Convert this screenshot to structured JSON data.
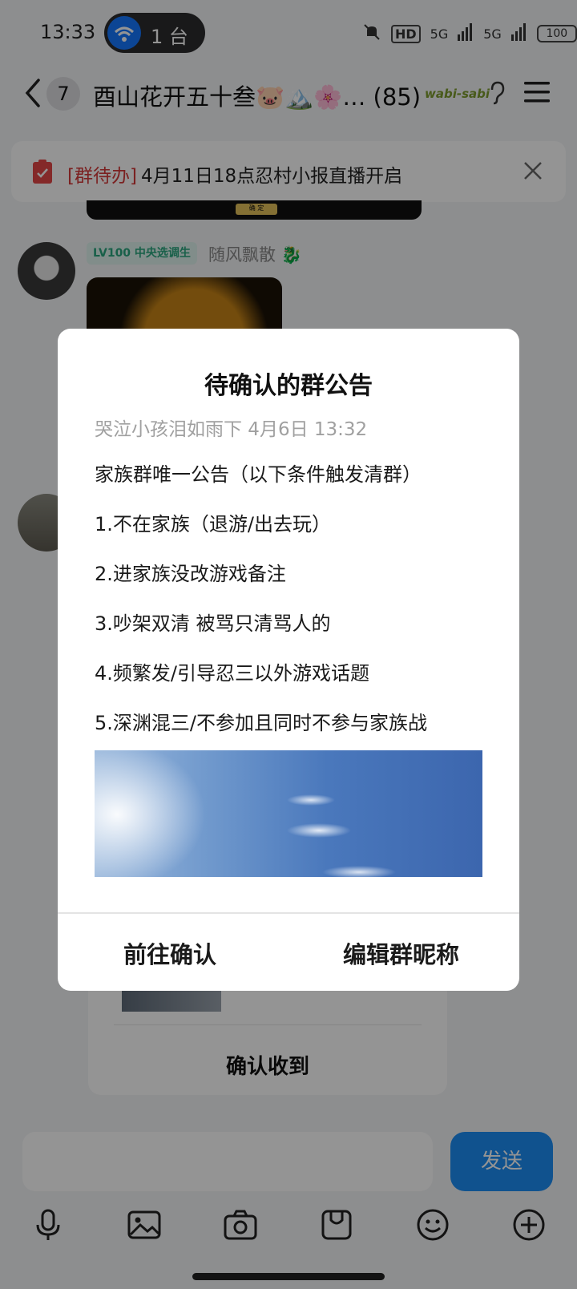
{
  "status_bar": {
    "time": "13:33",
    "hotspot_count": "1 台",
    "network_1": "5G",
    "network_2": "5G",
    "hd_label": "HD",
    "battery": "100"
  },
  "header": {
    "unread_count": "7",
    "title": "酉山花开五十叁🐷🏔️🌸… (85)",
    "badge_text": "wabi-sabi"
  },
  "todo_banner": {
    "tag": "[群待办]",
    "text": "4月11日18点忍村小报直播开启"
  },
  "chat": {
    "strip_button": "确 定",
    "level_badge": "LV100 中央选调生",
    "sender_name": "随风飘散 🐉",
    "card_confirm": "确认收到"
  },
  "dialog": {
    "title": "待确认的群公告",
    "meta": "哭泣小孩泪如雨下 4月6日 13:32",
    "lines": [
      "家族群唯一公告（以下条件触发清群）",
      "1.不在家族（退游/出去玩）",
      "2.进家族没改游戏备注",
      "3.吵架双清 被骂只清骂人的",
      "4.频繁发/引导忍三以外游戏话题",
      "5.深渊混三/不参加且同时不参与家族战"
    ],
    "button_left": "前往确认",
    "button_right": "编辑群昵称"
  },
  "input_bar": {
    "send_label": "发送",
    "tools": [
      "microphone-icon",
      "image-icon",
      "camera-icon",
      "sticker-icon",
      "emoji-icon",
      "plus-icon"
    ]
  },
  "colors": {
    "accent": "#1d8df5",
    "todo_tag": "#d53a3a",
    "level_badge_text": "#2aa57f"
  }
}
